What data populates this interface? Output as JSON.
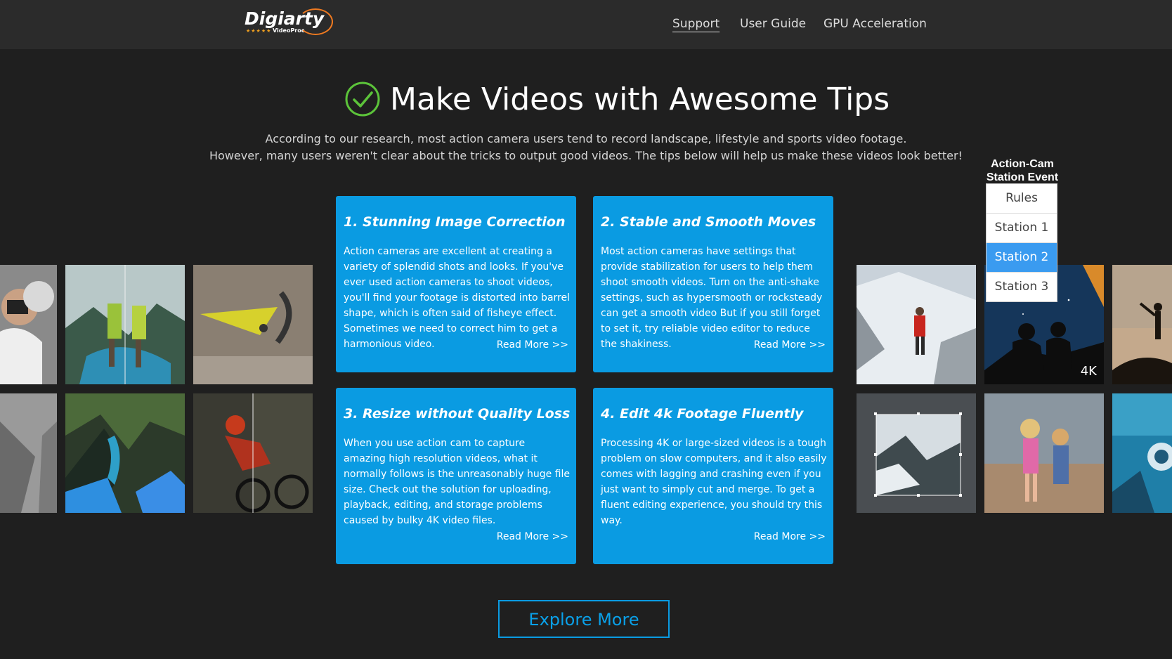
{
  "header": {
    "logo": {
      "brand": "Digiarty",
      "sub": "VideoProc"
    },
    "nav": [
      {
        "label": "Support",
        "active": true
      },
      {
        "label": "User Guide",
        "active": false
      },
      {
        "label": "GPU Acceleration",
        "active": false
      }
    ]
  },
  "hero": {
    "title": "Make Videos with Awesome Tips",
    "desc_line1": "According to our research, most action camera users tend to record landscape, lifestyle and sports video footage.",
    "desc_line2": "However, many users weren't clear about the tricks to output good videos. The tips below will help us make these videos look better!"
  },
  "cards": [
    {
      "title": "1. Stunning Image Correction",
      "body": "Action cameras are excellent at creating a variety of splendid shots and looks. If you've ever used action cameras to shoot videos, you'll find your footage is distorted into barrel shape, which is often said of fisheye effect. Sometimes we need to correct him to get a harmonious video.",
      "more": "Read More >>"
    },
    {
      "title": "2. Stable and Smooth Moves",
      "body": "Most action cameras have settings that provide stabilization for users to help them shoot smooth videos. Turn on the anti-shake settings, such as hypersmooth or rocksteady can get a smooth video But if you still forget to set it, try reliable video editor to reduce the shakiness.",
      "more": "Read More >>"
    },
    {
      "title": "3. Resize without Quality Loss",
      "body": "When you use action cam to capture amazing high resolution videos, what it normally follows is the unreasonably huge file size. Check out the solution for uploading, playback, editing, and storage problems caused by bulky 4K video files.",
      "more": "Read More >>"
    },
    {
      "title": "4. Edit 4k Footage Fluently",
      "body": "Processing 4K or large-sized videos is a tough problem on slow computers, and it also easily comes with lagging and crashing even if you just want to simply cut and merge. To get a fluent editing experience, you should try this way.",
      "more": "Read More >>"
    }
  ],
  "thumb_badge": "4K",
  "explore_label": "Explore More",
  "event_widget": {
    "title_line1": "Action-Cam",
    "title_line2": "Station Event",
    "items": [
      {
        "label": "Rules",
        "selected": false
      },
      {
        "label": "Station 1",
        "selected": false
      },
      {
        "label": "Station 2",
        "selected": true
      },
      {
        "label": "Station 3",
        "selected": false
      }
    ]
  },
  "colors": {
    "accent": "#0a9be2",
    "background": "#1f1f1f",
    "header": "#2b2b2b",
    "check": "#5cc33a",
    "menu_selected": "#3a9bf0"
  }
}
